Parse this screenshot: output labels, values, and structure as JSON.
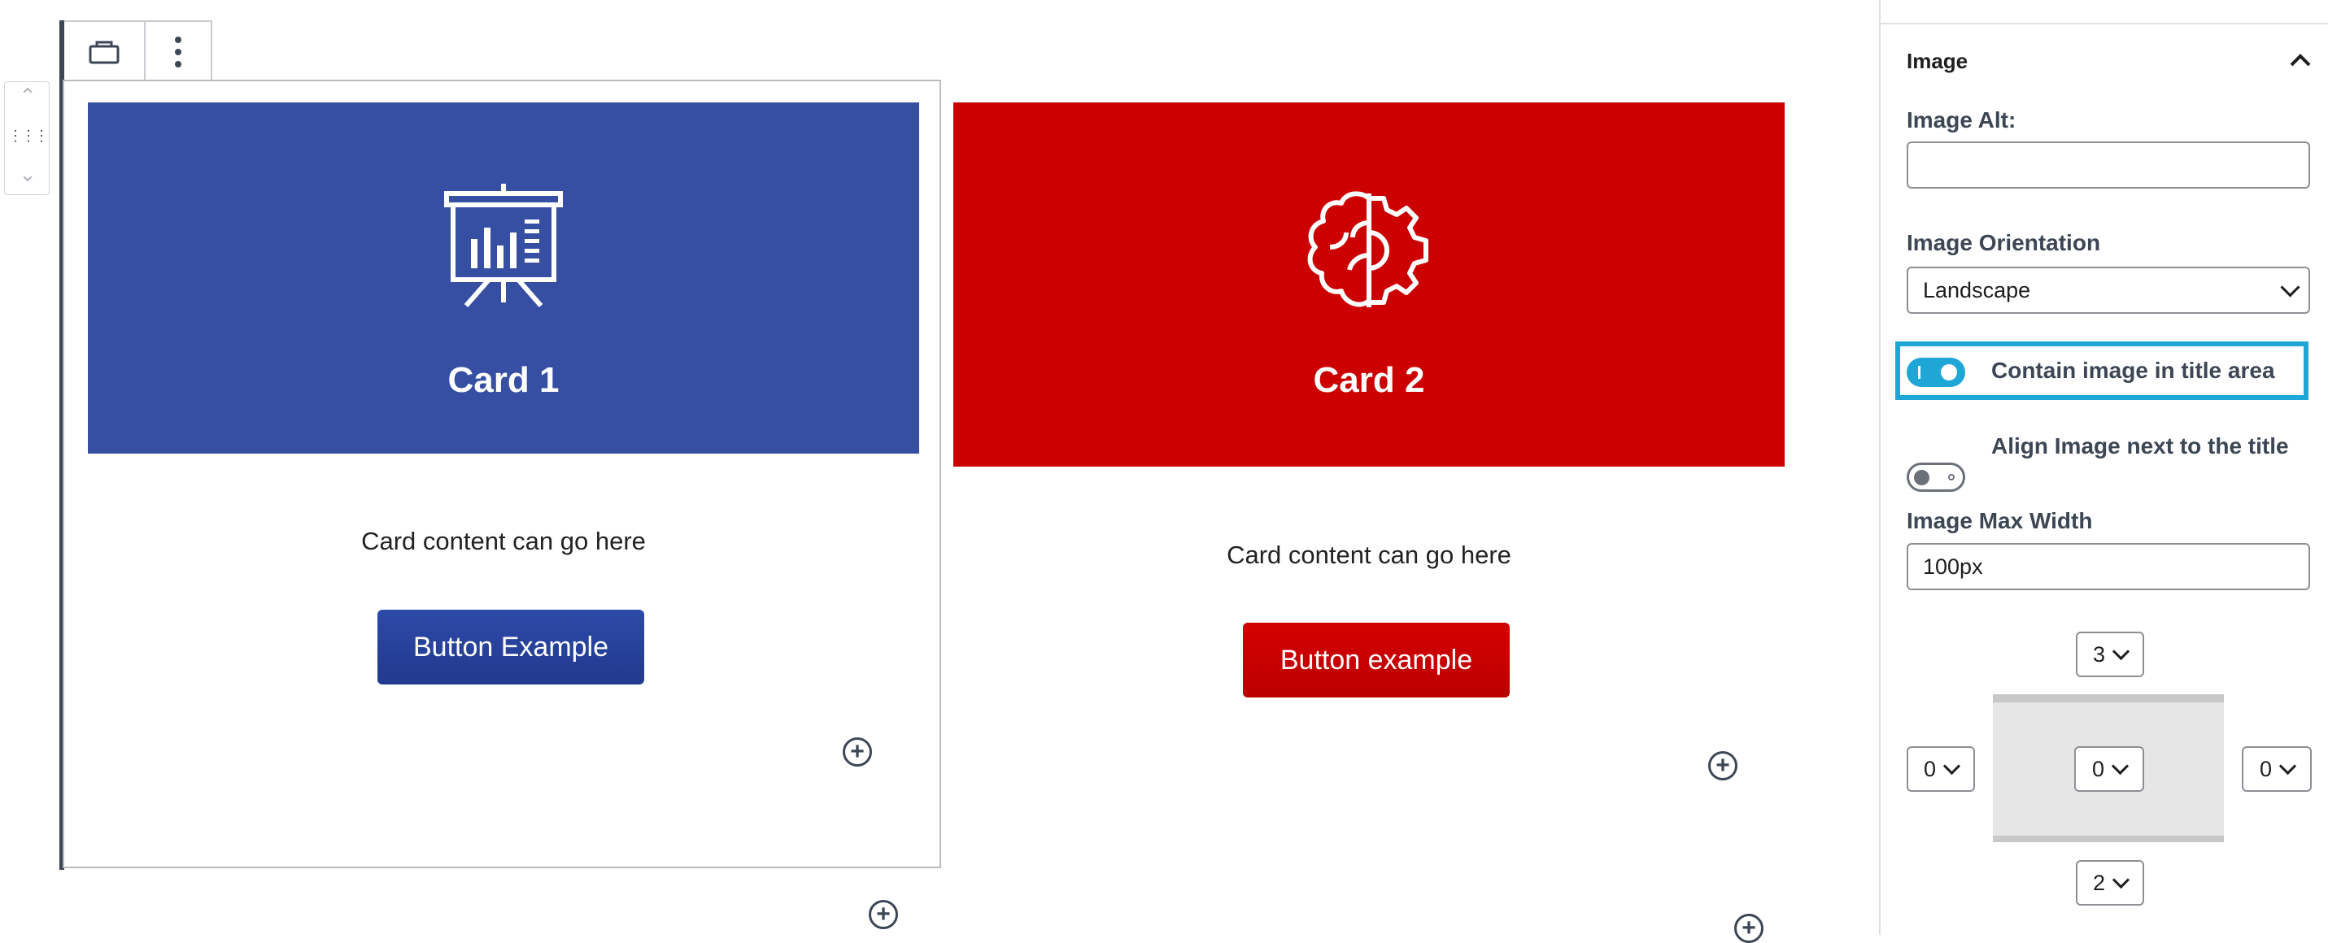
{
  "toolbar": {
    "block_icon": "card-block-icon",
    "options_icon": "more-vertical-icon"
  },
  "mover": {
    "up_icon": "chevron-up-icon",
    "drag_icon": "drag-handle-icon",
    "down_icon": "chevron-down-icon"
  },
  "cards": [
    {
      "title": "Card 1",
      "content": "Card content can go here",
      "button_label": "Button Example",
      "color": "#364fa3",
      "icon": "presentation-chart-icon"
    },
    {
      "title": "Card 2",
      "content": "Card content can go here",
      "button_label": "Button example",
      "color": "#cc0000",
      "icon": "brain-gear-icon"
    }
  ],
  "sidebar": {
    "panel_title": "Image",
    "image_alt": {
      "label": "Image Alt:",
      "value": ""
    },
    "orientation": {
      "label": "Image Orientation",
      "value": "Landscape"
    },
    "contain_toggle": {
      "label": "Contain image in title area",
      "on": true
    },
    "align_toggle": {
      "label": "Align Image next to the title",
      "on": false
    },
    "max_width": {
      "label": "Image Max Width",
      "value": "100px"
    },
    "spacing": {
      "top": "3",
      "left": "0",
      "center": "0",
      "right": "0",
      "bottom": "2"
    }
  },
  "colors": {
    "accent": "#1ea7d6",
    "card1": "#364fa3",
    "card2": "#cc0000"
  }
}
